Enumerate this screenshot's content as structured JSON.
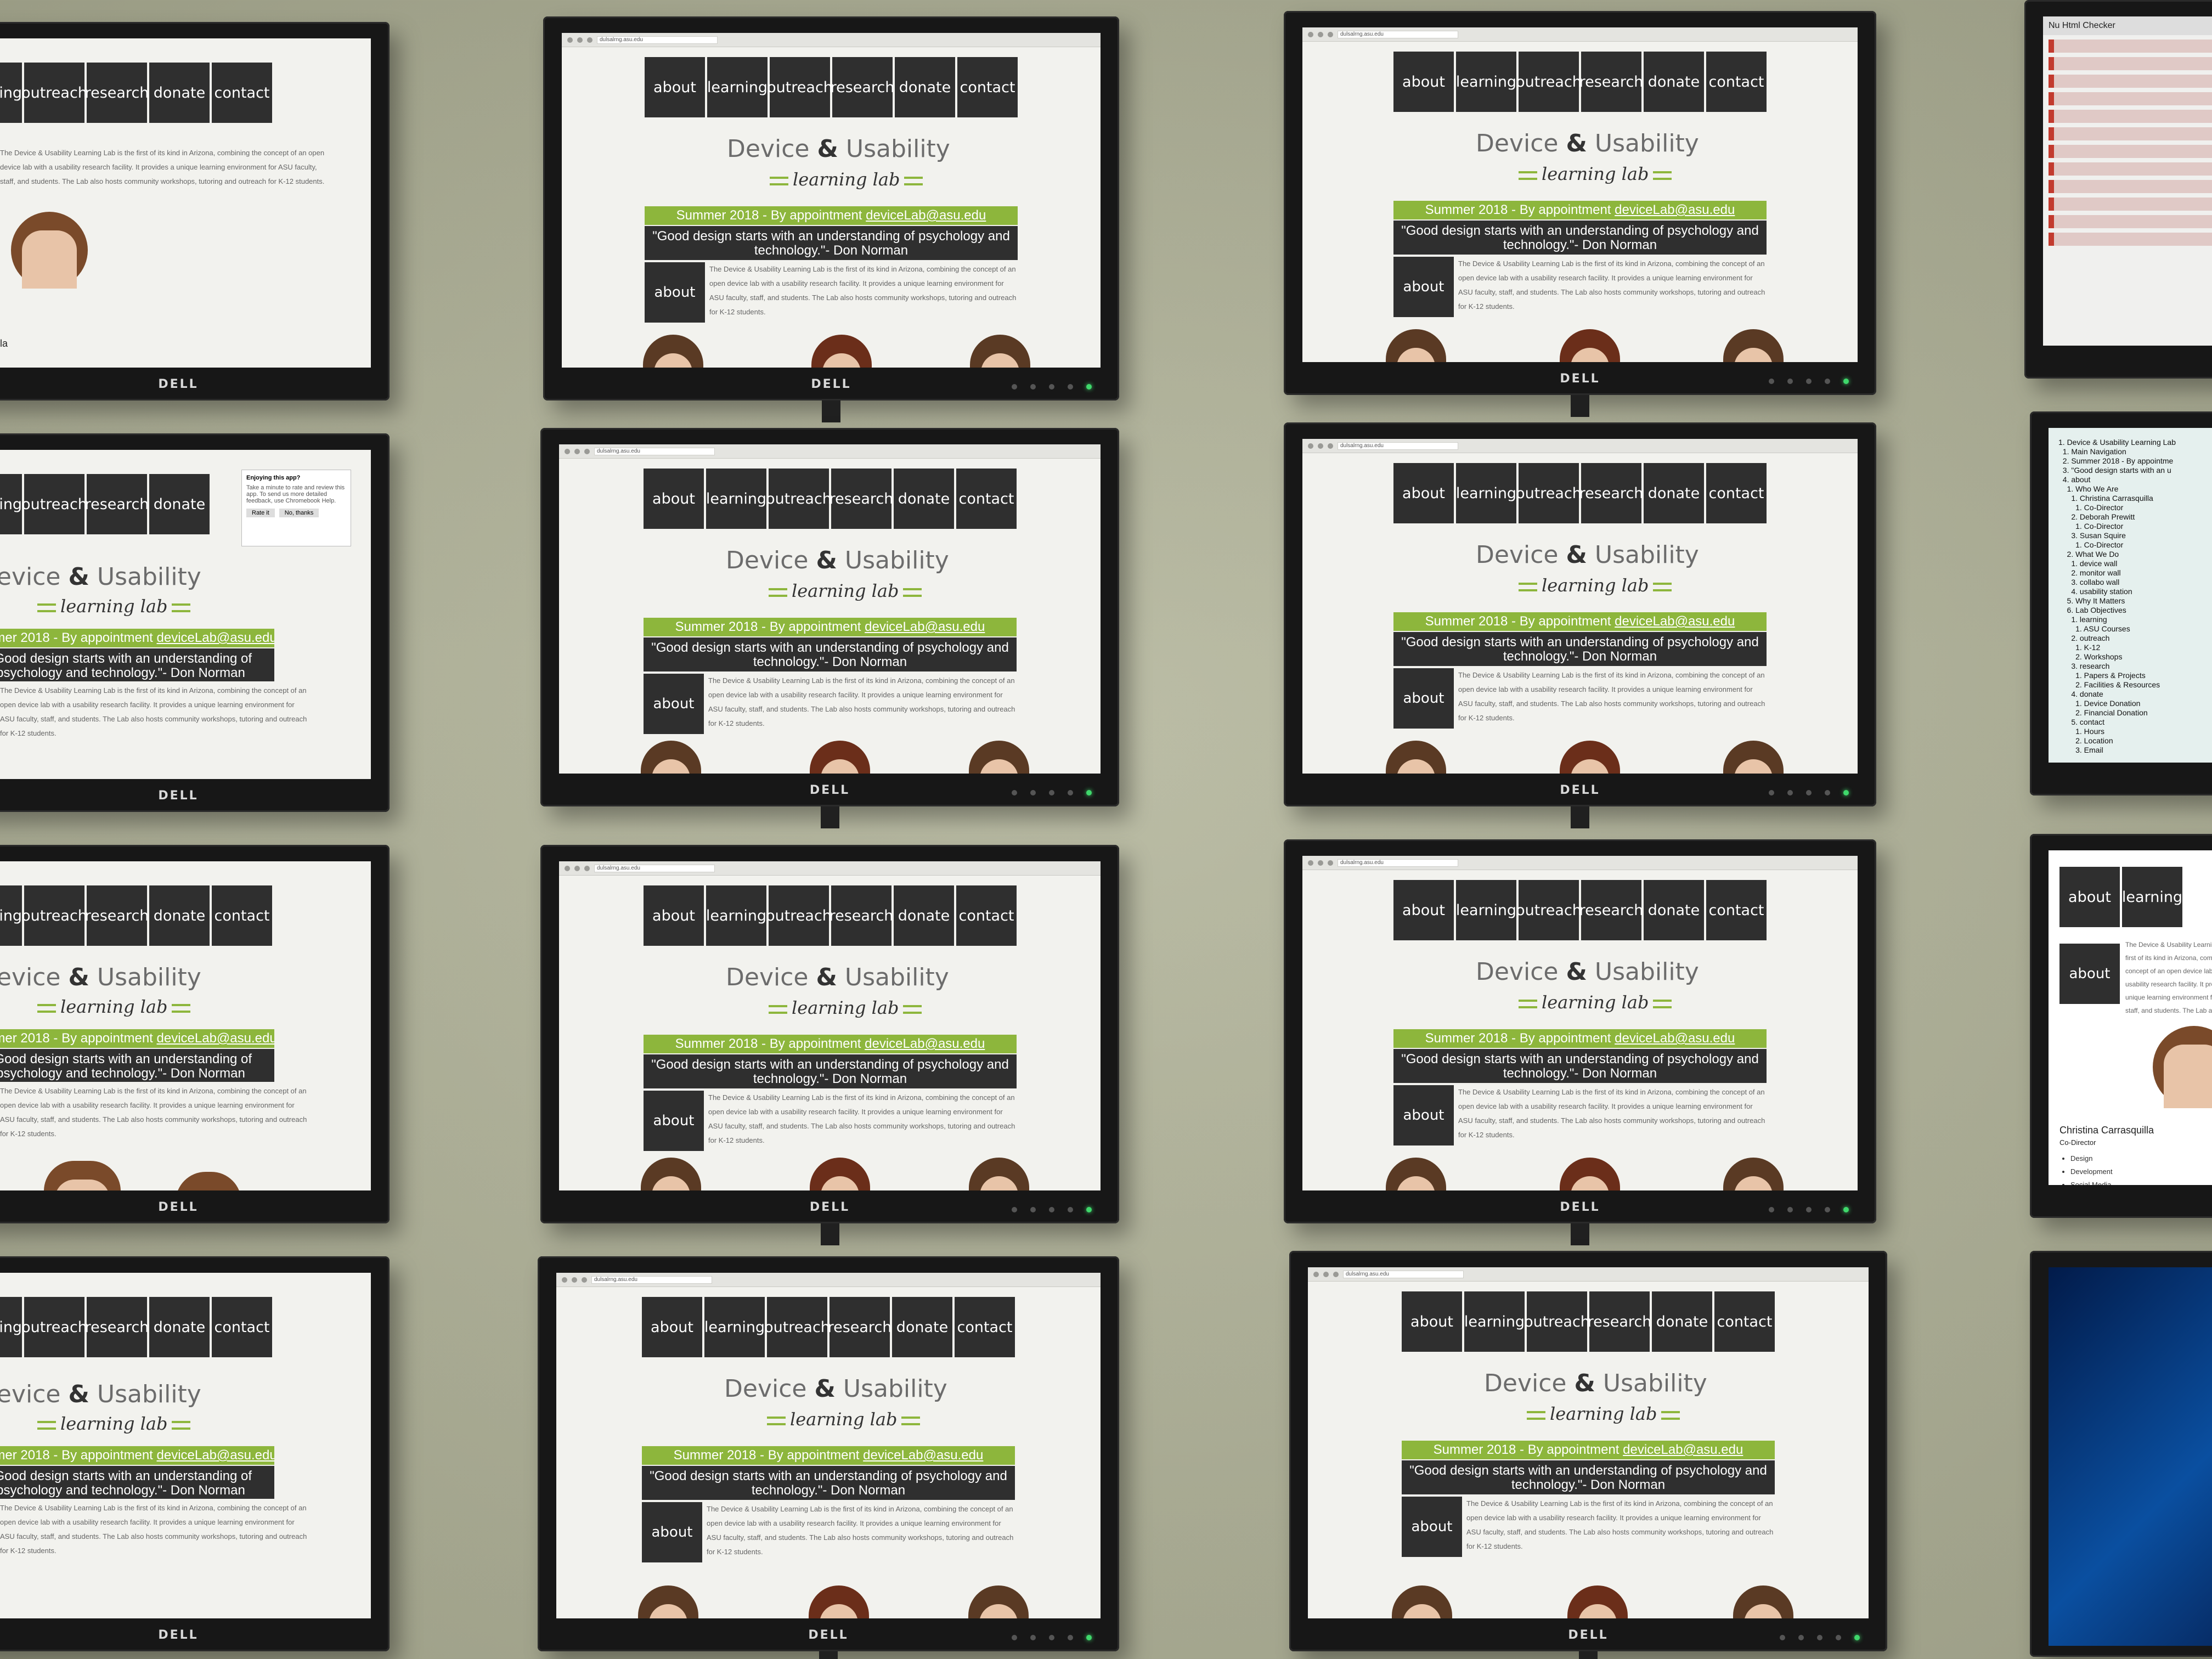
{
  "site": {
    "url": "dulsalrng.asu.edu",
    "nav": [
      "about",
      "learning",
      "outreach",
      "research",
      "donate",
      "contact"
    ],
    "logo_main_1": "Device",
    "logo_amp": "&",
    "logo_main_2": "Usability",
    "logo_sub": "learning lab",
    "banner_prefix": "Summer 2018 - By appointment ",
    "banner_email": "deviceLab@asu.edu",
    "quote": "\"Good design starts with an understanding of psychology and technology.\"- Don Norman",
    "about_label": "about",
    "description": "The Device & Usability Learning Lab is the first of its kind in Arizona, combining the concept of an open device lab with a usability research facility. It provides a unique learning environment for ASU faculty, staff, and students. The Lab also hosts community workshops, tutoring and outreach for K-12 students."
  },
  "monitor_brand": "DELL",
  "popup": {
    "title": "Enjoying this app?",
    "body": "Take a minute to rate and review this app. To send us more detailed feedback, use Chromebook Help.",
    "rate": "Rate it",
    "no_thanks": "No, thanks"
  },
  "checker_title": "Nu Html Checker",
  "outline": [
    "1. Device & Usability Learning Lab",
    "  1. Main Navigation",
    "  2. Summer 2018 - By appointme",
    "  3. \"Good design starts with an u",
    "  4. about",
    "    1. Who We Are",
    "      1. Christina Carrasquilla",
    "        1. Co-Director",
    "      2. Deborah Prewitt",
    "        1. Co-Director",
    "      3. Susan Squire",
    "        1. Co-Director",
    "    2. What We Do",
    "      1. device wall",
    "      2. monitor wall",
    "      3. collabo wall",
    "      4. usability station",
    "    5. Why It Matters",
    "    6. Lab Objectives",
    "      1. learning",
    "        1. ASU Courses",
    "      2. outreach",
    "        1. K-12",
    "        2. Workshops",
    "      3. research",
    "        1. Papers & Projects",
    "        2. Facilities & Resources",
    "      4. donate",
    "        1. Device Donation",
    "        2. Financial Donation",
    "      5. contact",
    "        1. Hours",
    "        2. Location",
    "        3. Email"
  ],
  "right_panel": {
    "name": "Christina Carrasquilla",
    "role": "Co-Director",
    "list": [
      "Design",
      "Development",
      "Social Media"
    ]
  },
  "partial_name": "la"
}
